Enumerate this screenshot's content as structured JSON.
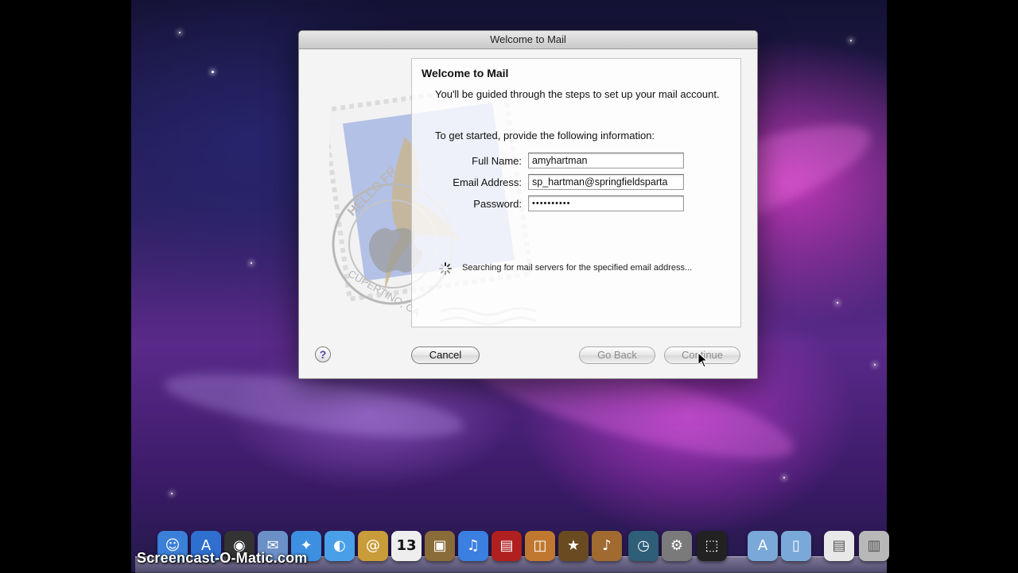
{
  "window": {
    "title": "Welcome to Mail"
  },
  "panel": {
    "heading": "Welcome to Mail",
    "intro": "You'll be guided through the steps to set up your mail account.",
    "prompt": "To get started, provide the following information:"
  },
  "form": {
    "full_name_label": "Full Name:",
    "full_name_value": "amyhartman",
    "email_label": "Email Address:",
    "email_value": "sp_hartman@springfieldsparta",
    "password_label": "Password:",
    "password_value": "••••••••••"
  },
  "status": "Searching for mail servers for the specified email address...",
  "buttons": {
    "help": "?",
    "cancel": "Cancel",
    "go_back": "Go Back",
    "continue": "Continue"
  },
  "watermark": "Screencast-O-Matic.com",
  "stamp": {
    "text_top": "HELLO FR",
    "text_bottom": "CUPERTINO, CA"
  },
  "calendar_day": "13",
  "dock": [
    {
      "name": "finder-icon",
      "glyph": "☺",
      "color": "#3a7fd8"
    },
    {
      "name": "app-store-icon",
      "glyph": "A",
      "color": "#2f6fd0"
    },
    {
      "name": "dashboard-icon",
      "glyph": "◉",
      "color": "#333333"
    },
    {
      "name": "mail-icon",
      "glyph": "✉",
      "color": "#6b8fc7"
    },
    {
      "name": "safari-icon",
      "glyph": "✦",
      "color": "#3d8fe0"
    },
    {
      "name": "ichat-icon",
      "glyph": "◐",
      "color": "#4aa0e8"
    },
    {
      "name": "address-book-icon",
      "glyph": "@",
      "color": "#c99c3a"
    },
    {
      "name": "ical-icon",
      "glyph": "13",
      "color": "#eeeeee"
    },
    {
      "name": "iphoto-icon",
      "glyph": "▣",
      "color": "#8a6b3a"
    },
    {
      "name": "itunes-icon",
      "glyph": "♫",
      "color": "#3b7fe0"
    },
    {
      "name": "photo-booth-icon",
      "glyph": "▤",
      "color": "#b02020"
    },
    {
      "name": "preview-icon",
      "glyph": "◫",
      "color": "#c07830"
    },
    {
      "name": "imovie-icon",
      "glyph": "★",
      "color": "#6a4a20"
    },
    {
      "name": "garageband-icon",
      "glyph": "♪",
      "color": "#a06a30"
    },
    {
      "name": "time-machine-icon",
      "glyph": "◷",
      "color": "#2e5e78"
    },
    {
      "name": "system-preferences-icon",
      "glyph": "⚙",
      "color": "#7a7a7a"
    },
    {
      "name": "screen-capture-icon",
      "glyph": "⬚",
      "color": "#222222"
    },
    {
      "name": "applications-folder-icon",
      "glyph": "A",
      "color": "#7aa8d8"
    },
    {
      "name": "documents-folder-icon",
      "glyph": "▯",
      "color": "#7aa8d8"
    },
    {
      "name": "pdf-document-icon",
      "glyph": "▤",
      "color": "#e8e8e8"
    },
    {
      "name": "trash-icon",
      "glyph": "▥",
      "color": "#b8b8b8"
    }
  ]
}
